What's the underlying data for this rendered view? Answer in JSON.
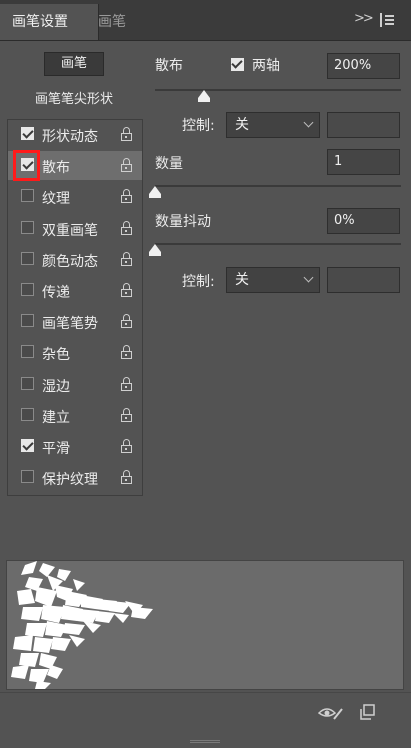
{
  "tabs": [
    {
      "label": "画笔设置",
      "active": true
    },
    {
      "label": "画笔",
      "active": false
    }
  ],
  "header_icons": {
    "collapse": ">>",
    "menu": "panel-menu-icon"
  },
  "brush_button": "画笔",
  "tip_shape_label": "画笔笔尖形状",
  "options": [
    {
      "label": "形状动态",
      "checked": true,
      "selected": false
    },
    {
      "label": "散布",
      "checked": true,
      "selected": true
    },
    {
      "label": "纹理",
      "checked": false,
      "selected": false
    },
    {
      "label": "双重画笔",
      "checked": false,
      "selected": false
    },
    {
      "label": "颜色动态",
      "checked": false,
      "selected": false
    },
    {
      "label": "传递",
      "checked": false,
      "selected": false
    },
    {
      "label": "画笔笔势",
      "checked": false,
      "selected": false
    },
    {
      "label": "杂色",
      "checked": false,
      "selected": false
    },
    {
      "label": "湿边",
      "checked": false,
      "selected": false
    },
    {
      "label": "建立",
      "checked": false,
      "selected": false
    },
    {
      "label": "平滑",
      "checked": true,
      "selected": false
    },
    {
      "label": "保护纹理",
      "checked": false,
      "selected": false
    }
  ],
  "scatter": {
    "label": "散布",
    "both_axes_label": "两轴",
    "both_axes_checked": true,
    "value": "200%",
    "slider_fraction": 0.2,
    "control_label": "控制:",
    "control_value": "关"
  },
  "count": {
    "label": "数量",
    "value": "1",
    "slider_fraction": 0.0
  },
  "count_jitter": {
    "label": "数量抖动",
    "value": "0%",
    "slider_fraction": 0.0,
    "control_label": "控制:",
    "control_value": "关"
  },
  "footer_icons": [
    "eye-brush-icon",
    "new-preset-icon"
  ],
  "colors": {
    "panel": "#535353",
    "tabbar": "#3b3b3b",
    "selected_row": "#6e6e6e",
    "highlight": "#ff1a1a"
  }
}
